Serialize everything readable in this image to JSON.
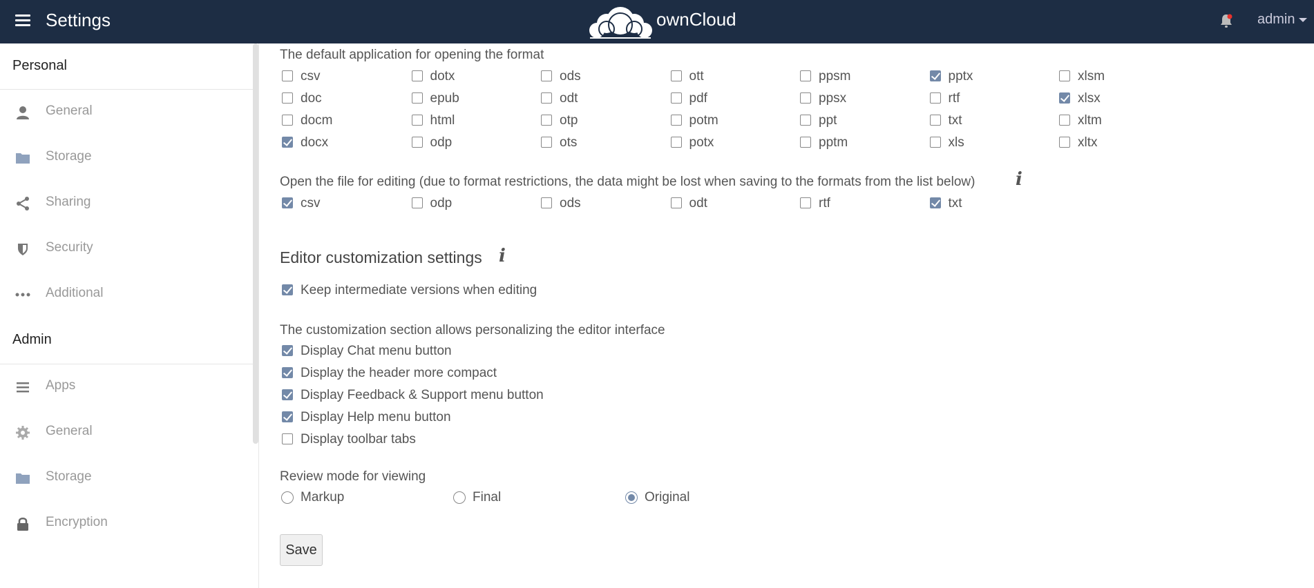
{
  "header": {
    "title": "Settings",
    "brand": "ownCloud",
    "user": "admin"
  },
  "sidebar": {
    "personal_heading": "Personal",
    "personal_items": [
      {
        "label": "General",
        "icon": "user-icon"
      },
      {
        "label": "Storage",
        "icon": "folder-icon"
      },
      {
        "label": "Sharing",
        "icon": "share-icon"
      },
      {
        "label": "Security",
        "icon": "shield-icon"
      },
      {
        "label": "Additional",
        "icon": "more-icon"
      }
    ],
    "admin_heading": "Admin",
    "admin_items": [
      {
        "label": "Apps",
        "icon": "list-icon"
      },
      {
        "label": "General",
        "icon": "gear-icon"
      },
      {
        "label": "Storage",
        "icon": "folder-icon"
      },
      {
        "label": "Encryption",
        "icon": "lock-icon"
      }
    ]
  },
  "main": {
    "default_app_label": "The default application for opening the format",
    "default_formats": [
      {
        "name": "csv",
        "checked": false
      },
      {
        "name": "dotx",
        "checked": false
      },
      {
        "name": "ods",
        "checked": false
      },
      {
        "name": "ott",
        "checked": false
      },
      {
        "name": "ppsm",
        "checked": false
      },
      {
        "name": "pptx",
        "checked": true
      },
      {
        "name": "xlsm",
        "checked": false
      },
      {
        "name": "doc",
        "checked": false
      },
      {
        "name": "epub",
        "checked": false
      },
      {
        "name": "odt",
        "checked": false
      },
      {
        "name": "pdf",
        "checked": false
      },
      {
        "name": "ppsx",
        "checked": false
      },
      {
        "name": "rtf",
        "checked": false
      },
      {
        "name": "xlsx",
        "checked": true
      },
      {
        "name": "docm",
        "checked": false
      },
      {
        "name": "html",
        "checked": false
      },
      {
        "name": "otp",
        "checked": false
      },
      {
        "name": "potm",
        "checked": false
      },
      {
        "name": "ppt",
        "checked": false
      },
      {
        "name": "txt",
        "checked": false
      },
      {
        "name": "xltm",
        "checked": false
      },
      {
        "name": "docx",
        "checked": true
      },
      {
        "name": "odp",
        "checked": false
      },
      {
        "name": "ots",
        "checked": false
      },
      {
        "name": "potx",
        "checked": false
      },
      {
        "name": "pptm",
        "checked": false
      },
      {
        "name": "xls",
        "checked": false
      },
      {
        "name": "xltx",
        "checked": false
      }
    ],
    "edit_label": "Open the file for editing (due to format restrictions, the data might be lost when saving to the formats from the list below)",
    "edit_formats": [
      {
        "name": "csv",
        "checked": true
      },
      {
        "name": "odp",
        "checked": false
      },
      {
        "name": "ods",
        "checked": false
      },
      {
        "name": "odt",
        "checked": false
      },
      {
        "name": "rtf",
        "checked": false
      },
      {
        "name": "txt",
        "checked": true
      }
    ],
    "editor_section_title": "Editor customization settings",
    "keep_versions_label": "Keep intermediate versions when editing",
    "keep_versions_checked": true,
    "customization_label": "The customization section allows personalizing the editor interface",
    "customization_options": [
      {
        "label": "Display Chat menu button",
        "checked": true
      },
      {
        "label": "Display the header more compact",
        "checked": true
      },
      {
        "label": "Display Feedback & Support menu button",
        "checked": true
      },
      {
        "label": "Display Help menu button",
        "checked": true
      },
      {
        "label": "Display toolbar tabs",
        "checked": false
      }
    ],
    "review_label": "Review mode for viewing",
    "review_options": [
      {
        "label": "Markup",
        "selected": false
      },
      {
        "label": "Final",
        "selected": false
      },
      {
        "label": "Original",
        "selected": true
      }
    ],
    "save_label": "Save",
    "info_glyph": "i"
  },
  "colors": {
    "header_bg": "#1d2d44",
    "checkbox_accent": "#7389a8",
    "notification_dot": "#e9322d"
  }
}
